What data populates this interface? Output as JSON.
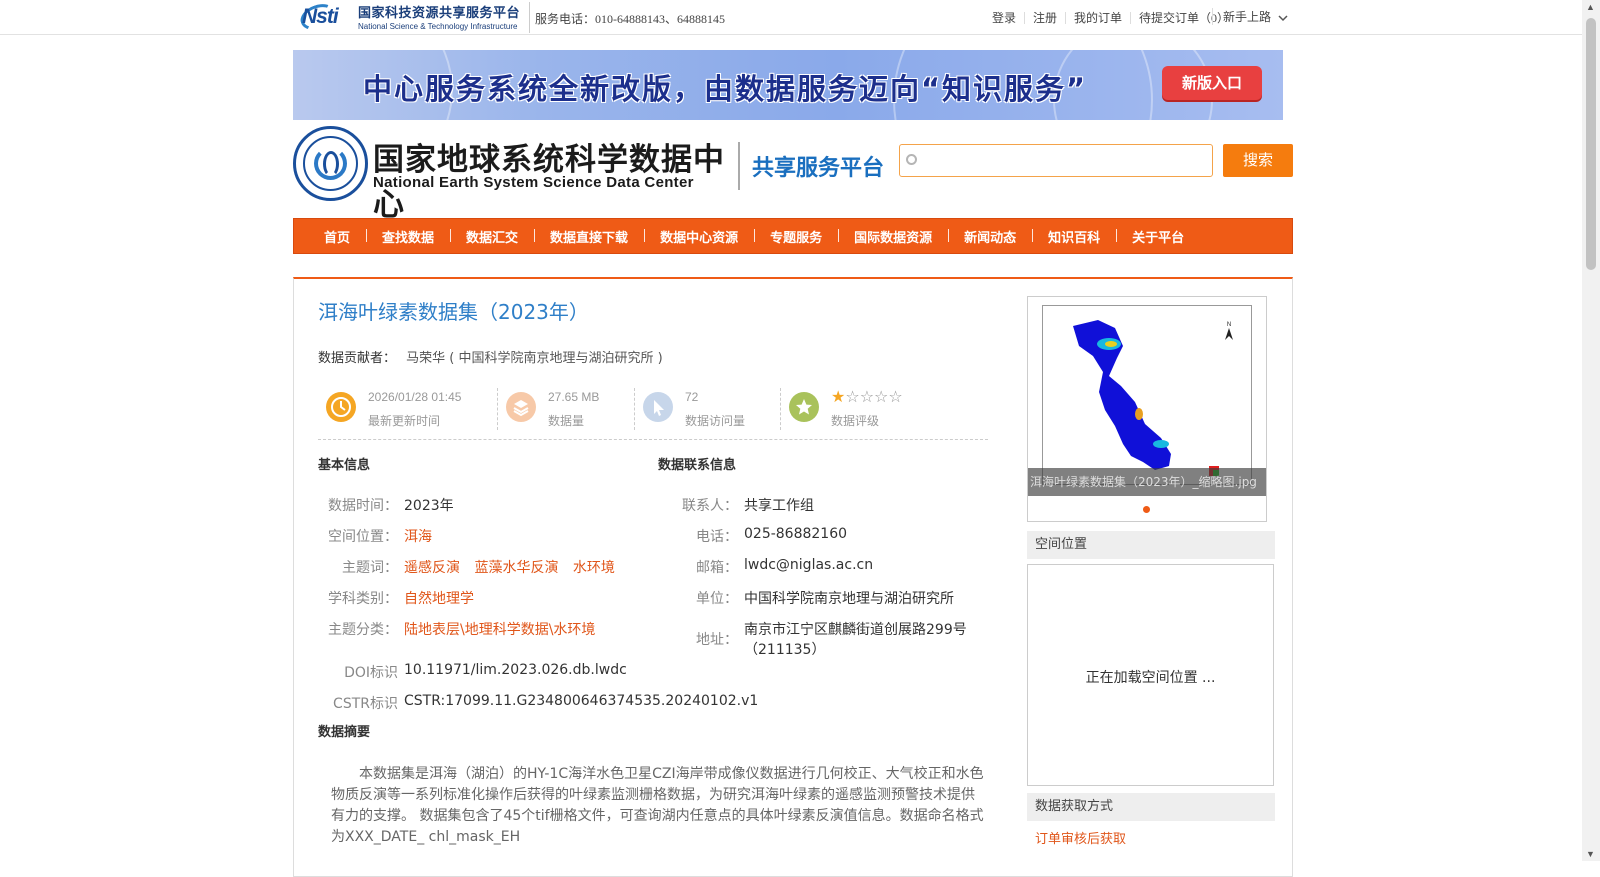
{
  "topbar": {
    "logo_cn": "国家科技资源共享服务平台",
    "logo_en": "National Science & Technology Infrastructure",
    "logo_mark": "Nsti",
    "phone": "服务电话：010-64888143、64888145",
    "links": [
      "登录",
      "注册",
      "我的订单",
      "待提交订单（0）"
    ],
    "guide": "新手上路"
  },
  "banner": {
    "text": "中心服务系统全新改版，由数据服务迈向“知识服务”",
    "button": "新版入口"
  },
  "header": {
    "center_cn": "国家地球系统科学数据中心",
    "center_en": "National Earth System Science Data Center",
    "platform": "共享服务平台",
    "search_placeholder": "",
    "search_button": "搜索"
  },
  "nav": [
    "首页",
    "查找数据",
    "数据汇交",
    "数据直接下载",
    "数据中心资源",
    "专题服务",
    "国际数据资源",
    "新闻动态",
    "知识百科",
    "关于平台"
  ],
  "dataset": {
    "title": "洱海叶绿素数据集（2023年）",
    "contributor_label": "数据贡献者：",
    "contributor": "马荣华 ( 中国科学院南京地理与湖泊研究所 )",
    "stats": [
      {
        "value": "2026/01/28 01:45",
        "label": "最新更新时间",
        "color": "#f5a623",
        "icon": "clock-icon"
      },
      {
        "value": "27.65 MB",
        "label": "数据量",
        "color": "#f7c9a8",
        "icon": "layers-icon"
      },
      {
        "value": "72",
        "label": "数据访问量",
        "color": "#c7d6ea",
        "icon": "cursor-icon"
      },
      {
        "value": "",
        "label": "数据评级",
        "color": "#a9c25b",
        "icon": "star-icon"
      }
    ],
    "rating": 1,
    "rating_max": 5,
    "basic_title": "基本信息",
    "basic": {
      "time_label": "数据时间：",
      "time": "2023年",
      "space_label": "空间位置：",
      "space": "洱海",
      "keywords_label": "主题词：",
      "keywords": [
        "遥感反演",
        "蓝藻水华反演",
        "水环境"
      ],
      "subject_label": "学科类别：",
      "subject": "自然地理学",
      "category_label": "主题分类：",
      "category": "陆地表层\\地理科学数据\\水环境",
      "doi_label": "DOI标识",
      "doi": "10.11971/lim.2023.026.db.lwdc",
      "cstr_label": "CSTR标识",
      "cstr": "CSTR:17099.11.G234800646374535.20240102.v1"
    },
    "contact_title": "数据联系信息",
    "contact": {
      "person_label": "联系人：",
      "person": "共享工作组",
      "phone_label": "电话：",
      "phone": "025-86882160",
      "email_label": "邮箱：",
      "email": "lwdc@niglas.ac.cn",
      "unit_label": "单位：",
      "unit": "中国科学院南京地理与湖泊研究所",
      "address_label": "地址：",
      "address_line1": "南京市江宁区麒麟街道创展路299号",
      "address_line2": "（211135）"
    },
    "abstract_title": "数据摘要",
    "abstract": "本数据集是洱海（湖泊）的HY-1C海洋水色卫星CZI海岸带成像仪数据进行几何校正、大气校正和水色物质反演等一系列标准化操作后获得的叶绿素监测栅格数据，为研究洱海叶绿素的遥感监测预警技术提供有力的支撑。 数据集包含了45个tif栅格文件，可查询湖内任意点的具体叶绿素反演值信息。数据命名格式为XXX_DATE_ chl_mask_EH"
  },
  "sidebar": {
    "thumb_caption": "洱海叶绿素数据集（2023年）_缩略图.jpg",
    "spatial_title": "空间位置",
    "spatial_loading": "正在加载空间位置 ...",
    "acquire_title": "数据获取方式",
    "acquire": "订单审核后获取"
  }
}
